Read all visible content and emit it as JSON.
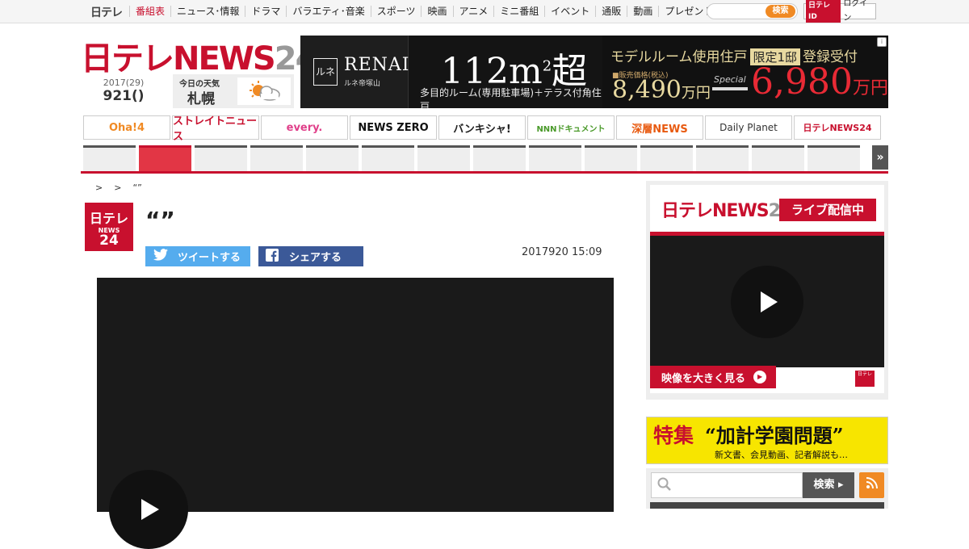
{
  "topbar": {
    "brand": "日テレ",
    "nav": [
      "番組表",
      "ニュース･情報",
      "ドラマ",
      "バラエティ･音楽",
      "スポーツ",
      "映画",
      "アニメ",
      "ミニ番組",
      "イベント",
      "通販",
      "動画",
      "プレゼント"
    ],
    "search_button": "検索",
    "id_mark": "日テレID",
    "login_label": "ログイン"
  },
  "header": {
    "logo_main": "日テレNEWS",
    "logo_num": "24",
    "date_year": "2017(29)",
    "date_day": "921()",
    "weather_label": "今日の天気",
    "weather_city": "札幌"
  },
  "ad": {
    "brand_mark": "ルネ",
    "brand": "RENAI",
    "brand_sub": "ルネ帝塚山",
    "size": "112m",
    "size_sup": "2",
    "size_suffix": "超",
    "desc": "多目的ルーム(専用駐車場)＋テラス付角住戸",
    "headline": "モデルルーム使用住戸",
    "tag": "限定1邸",
    "headline_end": "登録受付",
    "note": "■販売価格(税込)",
    "price_old": "8,490",
    "price_old_unit": "万円",
    "special": "Special",
    "price_new": "6,980",
    "price_new_unit": "万円"
  },
  "programs": [
    {
      "label": "Oha!4",
      "color": "#f08a24"
    },
    {
      "label": "ストレイトニュース",
      "color": "#c8102e"
    },
    {
      "label": "every.",
      "color": "#e0408a"
    },
    {
      "label": "NEWS ZERO",
      "color": "#111111"
    },
    {
      "label": "バンキシャ!",
      "color": "#222222"
    },
    {
      "label": "NNNドキュメント",
      "color": "#4a9a2a"
    },
    {
      "label": "深層NEWS",
      "color": "#e85a10"
    },
    {
      "label": "Daily Planet",
      "color": "#333333"
    },
    {
      "label": "日テレNEWS24",
      "color": "#c8102e"
    }
  ],
  "breadcrumb": [
    ">",
    ">",
    "“”"
  ],
  "article": {
    "icon_line1": "日テレ",
    "icon_line2": "NEWS",
    "icon_line3": "24",
    "title": "“”",
    "tweet_label": "ツイートする",
    "share_label": "シェアする",
    "timestamp": "2017920 15:09"
  },
  "sidebar": {
    "live_logo_main": "日テレNEWS",
    "live_logo_num": "24",
    "live_badge": "ライブ配信中",
    "watch_label": "映像を大きく見る",
    "mini_logo": "日テレ",
    "feature_tag": "特集",
    "feature_title": "“加計学園問題”",
    "feature_sub": "新文書、会見動画、記者解説も…",
    "search_button": "検索 ▸"
  }
}
